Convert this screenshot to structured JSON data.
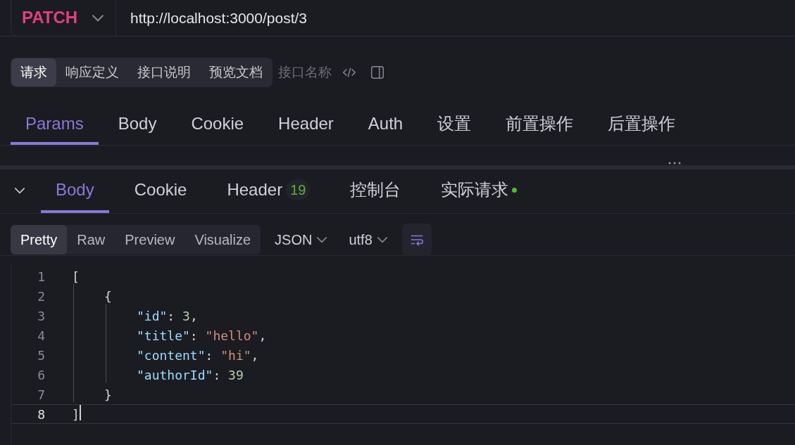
{
  "request": {
    "method": "PATCH",
    "url": "http://localhost:3000/post/3"
  },
  "mode_tabs": [
    {
      "label": "请求",
      "selected": true
    },
    {
      "label": "响应定义",
      "selected": false
    },
    {
      "label": "接口说明",
      "selected": false
    },
    {
      "label": "预览文档",
      "selected": false
    }
  ],
  "name_field": {
    "placeholder": "接口名称"
  },
  "request_tabs": [
    {
      "label": "Params",
      "selected": true
    },
    {
      "label": "Body",
      "selected": false
    },
    {
      "label": "Cookie",
      "selected": false
    },
    {
      "label": "Header",
      "selected": false
    },
    {
      "label": "Auth",
      "selected": false
    },
    {
      "label": "设置",
      "selected": false
    },
    {
      "label": "前置操作",
      "selected": false
    },
    {
      "label": "后置操作",
      "selected": false
    }
  ],
  "response_tabs": [
    {
      "label": "Body",
      "selected": true
    },
    {
      "label": "Cookie",
      "selected": false
    },
    {
      "label": "Header",
      "selected": false,
      "count": "19"
    },
    {
      "label": "控制台",
      "selected": false
    },
    {
      "label": "实际请求",
      "selected": false,
      "dot": true
    }
  ],
  "view_tabs": [
    {
      "label": "Pretty",
      "selected": true
    },
    {
      "label": "Raw",
      "selected": false
    },
    {
      "label": "Preview",
      "selected": false
    },
    {
      "label": "Visualize",
      "selected": false
    }
  ],
  "format": "JSON",
  "encoding": "utf8",
  "code": [
    {
      "number": "1",
      "tokens": [
        {
          "kind": "open",
          "text": "["
        }
      ]
    },
    {
      "number": "2",
      "tokens": [
        {
          "kind": "open",
          "text": "{"
        }
      ]
    },
    {
      "number": "3",
      "tokens": [
        {
          "kind": "key",
          "text": "\"id\""
        },
        {
          "kind": "punct",
          "text": ": "
        },
        {
          "kind": "number",
          "text": "3"
        },
        {
          "kind": "punct",
          "text": ","
        }
      ]
    },
    {
      "number": "4",
      "tokens": [
        {
          "kind": "key",
          "text": "\"title\""
        },
        {
          "kind": "punct",
          "text": ": "
        },
        {
          "kind": "string",
          "text": "\"hello\""
        },
        {
          "kind": "punct",
          "text": ","
        }
      ]
    },
    {
      "number": "5",
      "tokens": [
        {
          "kind": "key",
          "text": "\"content\""
        },
        {
          "kind": "punct",
          "text": ": "
        },
        {
          "kind": "string",
          "text": "\"hi\""
        },
        {
          "kind": "punct",
          "text": ","
        }
      ]
    },
    {
      "number": "6",
      "tokens": [
        {
          "kind": "key",
          "text": "\"authorId\""
        },
        {
          "kind": "punct",
          "text": ": "
        },
        {
          "kind": "number",
          "text": "39"
        }
      ]
    },
    {
      "number": "7",
      "tokens": [
        {
          "kind": "close",
          "text": "}"
        }
      ]
    },
    {
      "number": "8",
      "tokens": [
        {
          "kind": "close",
          "text": "]"
        }
      ],
      "current": true
    }
  ]
}
